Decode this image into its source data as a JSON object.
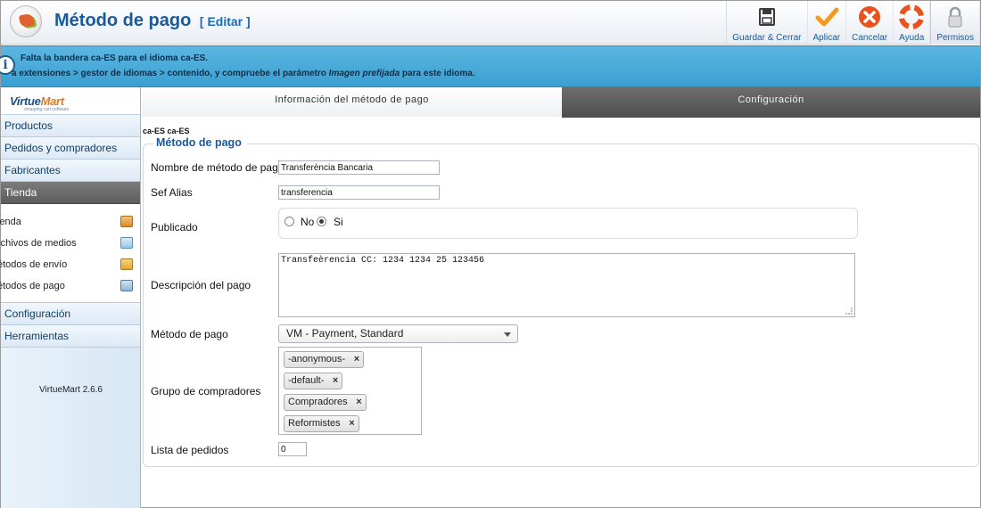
{
  "header": {
    "title": "Método de pago",
    "edit_label": "[ Editar ]"
  },
  "toolbar": {
    "buttons": [
      {
        "label": "Guardar & Cerrar",
        "icon": "save-icon"
      },
      {
        "label": "Aplicar",
        "icon": "check-icon"
      },
      {
        "label": "Cancelar",
        "icon": "cancel-icon"
      },
      {
        "label": "Ayuda",
        "icon": "help-icon"
      },
      {
        "label": "Permisos",
        "icon": "lock-icon"
      }
    ]
  },
  "message": {
    "line1": "Falta la bandera ca-ES para el idioma ca-ES.",
    "line2_pre": "a extensiones > gestor de idiomas > contenido, y compruebe el parámetro ",
    "line2_em": "Imagen prefijada",
    "line2_post": " para este idioma."
  },
  "sidebar": {
    "logo": "VirtueMart",
    "logo_sub": "shopping cart software",
    "items": [
      "Productos",
      "Pedidos y compradores",
      "Fabricantes",
      "Tienda"
    ],
    "subitems": [
      "ienda",
      "rchivos de medios",
      "étodos de envío",
      "étodos de pago"
    ],
    "items_after": [
      "Configuración",
      "Herramientas"
    ],
    "version": "VirtueMart 2.6.6"
  },
  "tabs": [
    "Información del método de pago",
    "Configuración"
  ],
  "form": {
    "lang_note": "ca-ES ca-ES",
    "legend": "Método de pago",
    "name_label": "Nombre de método de pago",
    "name_value": "Transferència Bancaria",
    "alias_label": "Sef Alias",
    "alias_value": "transferencia",
    "published_label": "Publicado",
    "radio_no": "No",
    "radio_si": "Si",
    "desc_label": "Descripción del pago",
    "desc_value": "Transfeèrencia CC: 1234 1234 25 123456",
    "method_label": "Método de pago",
    "method_value": "VM - Payment, Standard",
    "groups_label": "Grupo de compradores",
    "groups": [
      "-anonymous-",
      "-default-",
      "Compradores",
      "Reformistes"
    ],
    "orders_label": "Lista de pedidos",
    "orders_value": "0"
  },
  "colors": {
    "title": "#1a5a9a",
    "message_bar": "#3a9fd2",
    "active_menu": "#5d5d5d"
  }
}
